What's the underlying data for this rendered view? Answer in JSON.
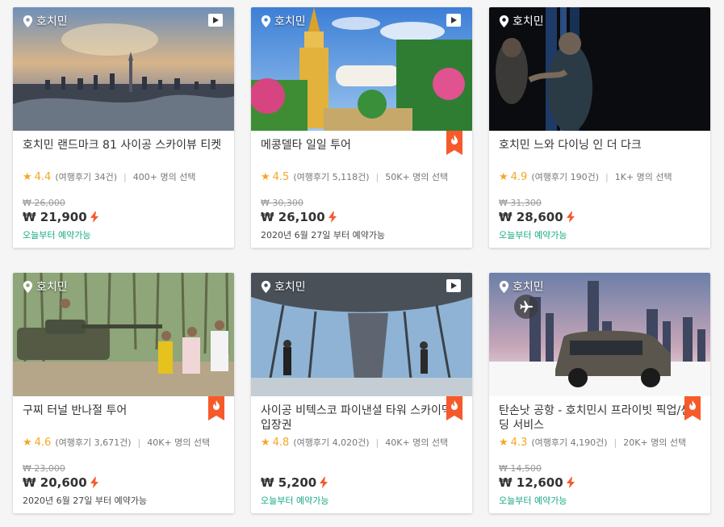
{
  "cards": [
    {
      "location": "호치민",
      "title": "호치민 랜드마크 81 사이공 스카이뷰 티켓",
      "score": "4.4",
      "reviews": "(여행후기 34건)",
      "chosen": "400+ 명의 선택",
      "old_price": "₩ 26,000",
      "price": "₩ 21,900",
      "availability": "오늘부터 예약가능",
      "has_video": true,
      "has_badge": false
    },
    {
      "location": "호치민",
      "title": "메콩델타 일일 투어",
      "score": "4.5",
      "reviews": "(여행후기 5,118건)",
      "chosen": "50K+ 명의 선택",
      "old_price": "₩ 30,300",
      "price": "₩ 26,100",
      "availability": "2020년 6월 27일 부터 예약가능",
      "has_video": true,
      "has_badge": true
    },
    {
      "location": "호치민",
      "title": "호치민 느와 다이닝 인 더 다크",
      "score": "4.9",
      "reviews": "(여행후기 190건)",
      "chosen": "1K+ 명의 선택",
      "old_price": "₩ 31,300",
      "price": "₩ 28,600",
      "availability": "오늘부터 예약가능",
      "has_video": false,
      "has_badge": false
    },
    {
      "location": "호치민",
      "title": "구찌 터널 반나절 투어",
      "score": "4.6",
      "reviews": "(여행후기 3,671건)",
      "chosen": "40K+ 명의 선택",
      "old_price": "₩ 23,000",
      "price": "₩ 20,600",
      "availability": "2020년 6월 27일 부터 예약가능",
      "has_video": false,
      "has_badge": true
    },
    {
      "location": "호치민",
      "title": "사이공 비텍스코 파이낸셜 타워 스카이덱 입장권",
      "score": "4.8",
      "reviews": "(여행후기 4,020건)",
      "chosen": "40K+ 명의 선택",
      "old_price": "",
      "price": "₩ 5,200",
      "availability": "오늘부터 예약가능",
      "has_video": true,
      "has_badge": true
    },
    {
      "location": "호치민",
      "title": "탄손낫 공항 - 호치민시 프라이빗 픽업/샌딩 서비스",
      "score": "4.3",
      "reviews": "(여행후기 4,190건)",
      "chosen": "20K+ 명의 선택",
      "old_price": "₩ 14,500",
      "price": "₩ 12,600",
      "availability": "오늘부터 예약가능",
      "has_video": false,
      "has_badge": true
    }
  ],
  "colors": {
    "accent_orange": "#f65a2b",
    "star": "#f6a623",
    "available_green": "#16a983"
  },
  "icons": {
    "location": "map-pin-icon",
    "video": "play-icon",
    "badge": "fire-icon",
    "instant": "lightning-icon",
    "transfer": "airplane-icon",
    "rating": "star-icon"
  }
}
